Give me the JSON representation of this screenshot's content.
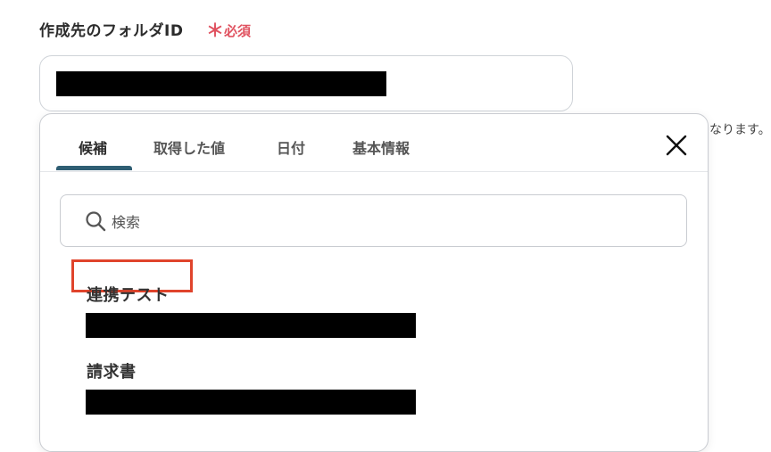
{
  "field": {
    "label": "作成先のフォルダID",
    "required_mark": "＊",
    "required_text": "必須",
    "help_text": "なります。"
  },
  "dropdown": {
    "tabs": [
      {
        "label": "候補",
        "active": true
      },
      {
        "label": "取得した値",
        "active": false
      },
      {
        "label": "日付",
        "active": false
      },
      {
        "label": "基本情報",
        "active": false
      }
    ],
    "search": {
      "placeholder": "検索",
      "value": ""
    },
    "items": [
      {
        "title": "連携テスト",
        "highlighted": true
      },
      {
        "title": "請求書",
        "highlighted": false
      }
    ]
  },
  "colors": {
    "accent": "#2f5e73",
    "required": "#e05260",
    "highlight_border": "#e0442c"
  },
  "icons": {
    "close": "close-icon",
    "search": "search-icon"
  }
}
